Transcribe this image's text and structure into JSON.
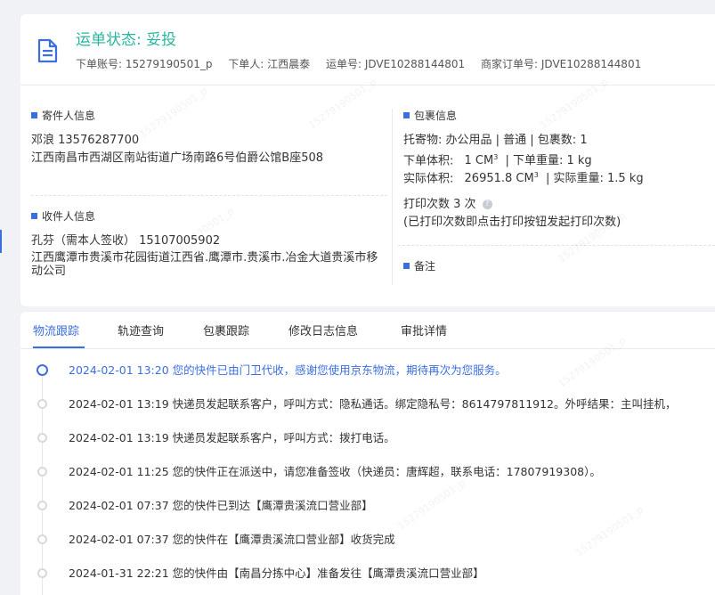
{
  "header": {
    "status": "运单状态: 妥投",
    "order_account": "下单账号: 15279190501_p",
    "orderer": "下单人: 江西晨泰",
    "waybill_no": "运单号: JDVE10288144801",
    "merchant_order_no": "商家订单号: JDVE10288144801"
  },
  "sender": {
    "title": "寄件人信息",
    "name_phone": "邓浪   13576287700",
    "address": "江西南昌市西湖区南站街道广场南路6号伯爵公馆B座508"
  },
  "receiver": {
    "title": "收件人信息",
    "name_phone": "孔芬（需本人签收）  15107005902",
    "address": "江西鹰潭市贵溪市花园街道江西省.鹰潭市.贵溪市.冶金大道贵溪市移动公司"
  },
  "package": {
    "title": "包裹信息",
    "goods": "托寄物:   办公用品 | 普通 | 包裹数:  1",
    "order_volume_label": "下单体积:",
    "order_volume_value": "1 CM",
    "order_weight": "| 下单重量:   1 kg",
    "actual_volume_label": "实际体积:",
    "actual_volume_value": "26951.8 CM",
    "actual_weight": "| 实际重量:   1.5 kg",
    "volume_unit_sup": "3",
    "print_count": "打印次数   3 次",
    "print_note": "(已打印次数即点击打印按钮发起打印次数)"
  },
  "remark": {
    "title": "备注"
  },
  "tabs": [
    {
      "label": "物流跟踪",
      "active": true
    },
    {
      "label": "轨迹查询"
    },
    {
      "label": "包裹跟踪"
    },
    {
      "label": "修改日志信息"
    },
    {
      "label": "审批详情"
    }
  ],
  "timeline": [
    {
      "text": "2024-02-01 13:20 您的快件已由门卫代收，感谢您使用京东物流，期待再次为您服务。",
      "active": true
    },
    {
      "text": "2024-02-01 13:19 快递员发起联系客户，呼叫方式：隐私通话。绑定隐私号：8614797811912。外呼结果：主叫挂机，"
    },
    {
      "text": "2024-02-01 13:19 快递员发起联系客户，呼叫方式：拨打电话。"
    },
    {
      "text": "2024-02-01 11:25 您的快件正在派送中，请您准备签收（快递员：唐辉超，联系电话：17807919308）。"
    },
    {
      "text": "2024-02-01 07:37 您的快件已到达【鹰潭贵溪流口营业部】"
    },
    {
      "text": "2024-02-01 07:37 您的快件在【鹰潭贵溪流口营业部】收货完成"
    },
    {
      "text": "2024-01-31 22:21 您的快件由【南昌分拣中心】准备发往【鹰潭贵溪流口营业部】"
    }
  ],
  "watermark": "15279190501_p",
  "colors": {
    "accent": "#3b6fe0",
    "status": "#2bb5a0"
  }
}
